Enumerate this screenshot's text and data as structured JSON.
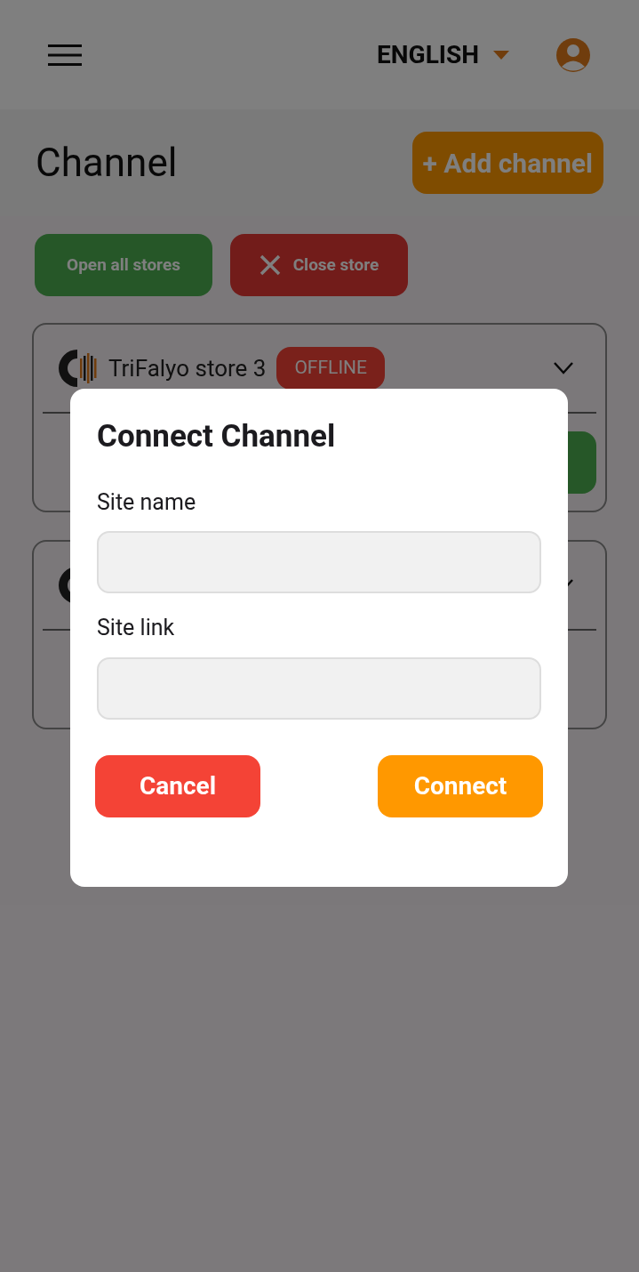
{
  "header": {
    "language": "ENGLISH"
  },
  "page": {
    "title": "Channel",
    "add_button": "+ Add channel"
  },
  "actions": [
    {
      "label": "Open all stores",
      "kind": "open"
    },
    {
      "label": "Close store",
      "kind": "close"
    }
  ],
  "stores": [
    {
      "name": "TriFalyo store 3",
      "status": "OFFLINE"
    }
  ],
  "dialog": {
    "title": "Connect Channel",
    "fields": [
      {
        "label": "Site name"
      },
      {
        "label": "Site link"
      }
    ],
    "buttons": [
      {
        "label": "Cancel",
        "kind": "cancel"
      },
      {
        "label": "Connect",
        "kind": "confirm"
      }
    ]
  }
}
